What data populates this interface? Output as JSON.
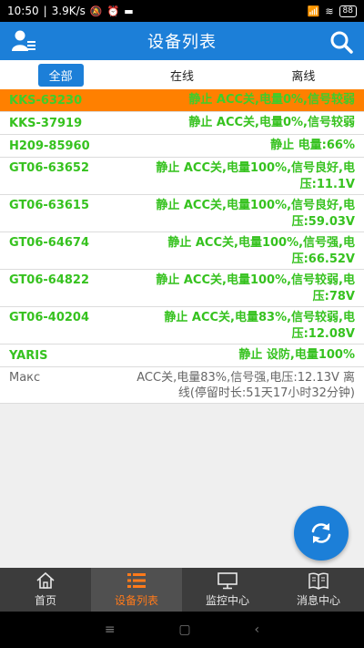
{
  "statusbar": {
    "time": "10:50",
    "speed": "3.9K/s",
    "signal": "5G",
    "battery": "88"
  },
  "header": {
    "title": "设备列表"
  },
  "filters": [
    "全部",
    "在线",
    "离线"
  ],
  "devices": [
    {
      "name": "KKS-63230",
      "status": "静止 ACC关,电量0%,信号较弱"
    },
    {
      "name": "KKS-37919",
      "status": "静止 ACC关,电量0%,信号较弱"
    },
    {
      "name": "H209-85960",
      "status": "静止 电量:66%"
    },
    {
      "name": "GT06-63652",
      "status": "静止 ACC关,电量100%,信号良好,电压:11.1V"
    },
    {
      "name": "GT06-63615",
      "status": "静止 ACC关,电量100%,信号良好,电压:59.03V"
    },
    {
      "name": "GT06-64674",
      "status": "静止 ACC关,电量100%,信号强,电压:66.52V"
    },
    {
      "name": "GT06-64822",
      "status": "静止 ACC关,电量100%,信号较弱,电压:78V"
    },
    {
      "name": "GT06-40204",
      "status": "静止 ACC关,电量83%,信号较弱,电压:12.08V"
    },
    {
      "name": "YARIS",
      "status": "静止 设防,电量100%"
    },
    {
      "name": "Макс",
      "status": "ACC关,电量83%,信号强,电压:12.13V 离线(停留时长:51天17小时32分钟)"
    }
  ],
  "tabs": [
    "首页",
    "设备列表",
    "监控中心",
    "消息中心"
  ],
  "icons": {
    "user": "user-list-icon",
    "search": "search-icon",
    "refresh": "refresh-icon",
    "home": "home-icon",
    "list": "list-icon",
    "monitor": "monitor-icon",
    "message": "book-icon"
  },
  "colors": {
    "primary": "#1c7fd8",
    "highlight": "#ff8000",
    "online_text": "#36c21f",
    "offline_text": "#666666",
    "tab_active": "#ff7a1a"
  }
}
